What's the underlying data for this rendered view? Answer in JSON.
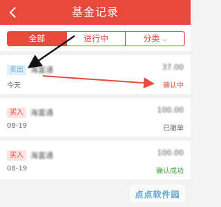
{
  "header": {
    "title": "基金记录",
    "back_icon": "chevron-left-icon",
    "background": "#e8493d"
  },
  "tabs": [
    {
      "label": "全部",
      "active": true
    },
    {
      "label": "进行中",
      "active": false
    },
    {
      "label": "分类",
      "active": false,
      "caret": "⌵"
    }
  ],
  "records": [
    {
      "type": "卖出",
      "fund_name": "海富通",
      "amount": "37.00",
      "date": "今天",
      "status": "确认中"
    },
    {
      "type": "买入",
      "fund_name": "海富通",
      "amount": "100.00",
      "date": "08-19",
      "status": "已撤单"
    },
    {
      "type": "买入",
      "fund_name": "海富通",
      "amount": "100.00",
      "date": "08-19",
      "status": "确认成功"
    }
  ],
  "watermark": {
    "text": "点点软件园"
  },
  "colors": {
    "accent": "#e8493d",
    "sell_badge": "#6aaed8",
    "success": "#3aa63a"
  }
}
